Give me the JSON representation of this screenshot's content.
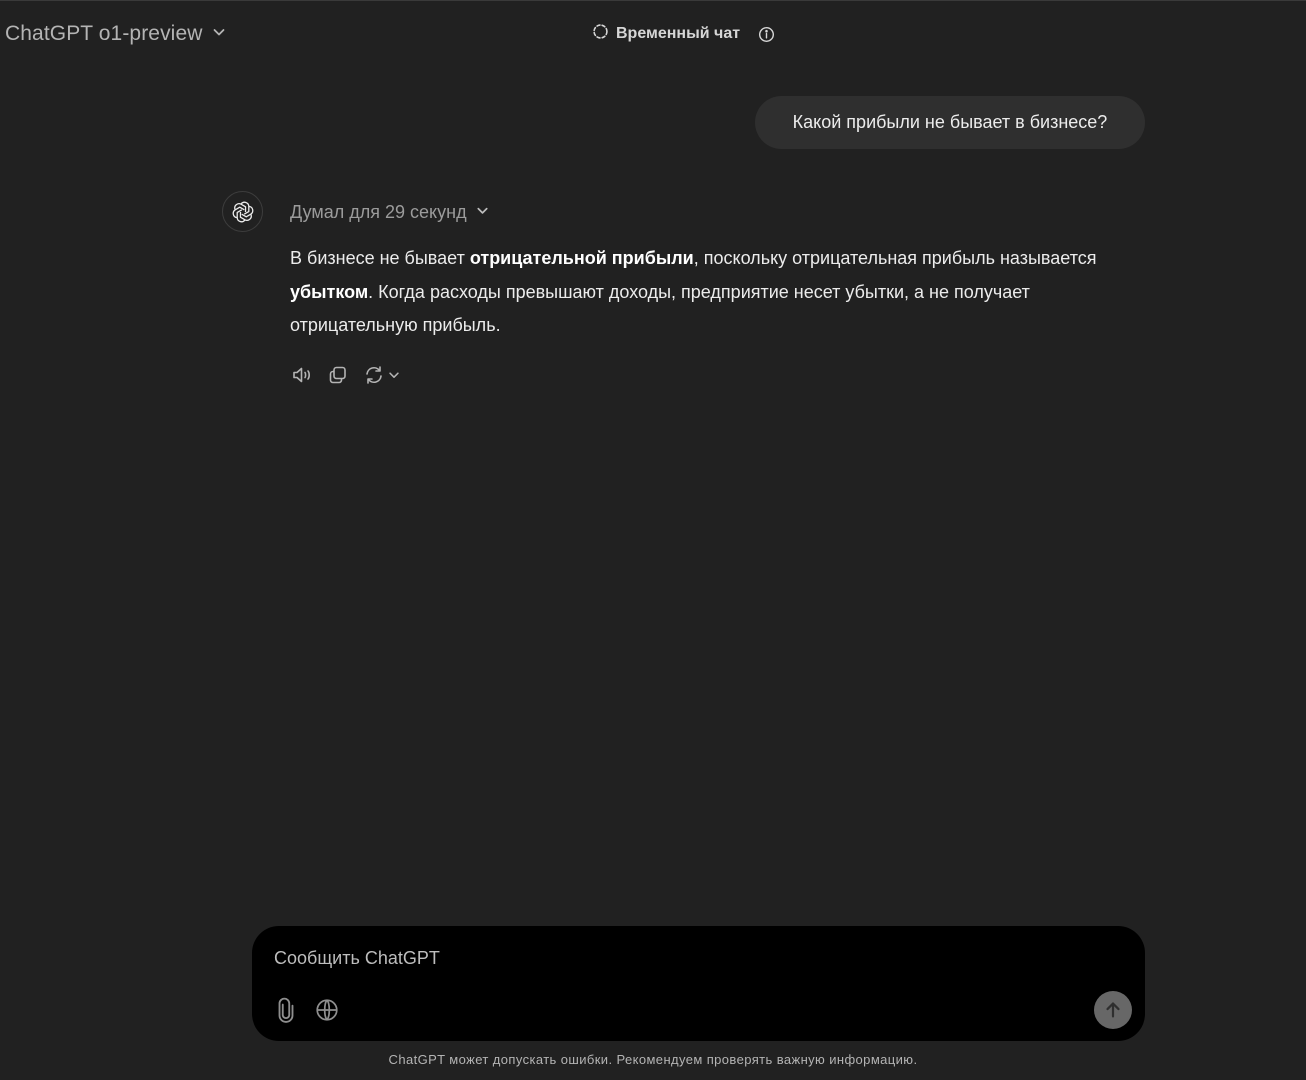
{
  "header": {
    "model_name": "ChatGPT o1-preview",
    "temp_chat_label": "Временный чат"
  },
  "conversation": {
    "user_message": "Какой прибыли не бывает в бизнесе?",
    "thought_label": "Думал для 29 секунд",
    "answer": {
      "p1_a": "В бизнесе не бывает ",
      "p1_bold": "отрицательной прибыли",
      "p1_b": ", поскольку отрицательная прибыль называется ",
      "p1_bold2": "убытком",
      "p1_c": ". Когда расходы превышают доходы, предприятие несет убытки, а не получает отрицательную прибыль."
    },
    "actions": [
      "speaker-icon",
      "copy-icon",
      "regenerate-icon"
    ]
  },
  "composer": {
    "placeholder": "Сообщить ChatGPT",
    "tools": [
      "paperclip-icon",
      "globe-icon"
    ],
    "send_icon": "arrow-up-icon"
  },
  "footer": {
    "disclaimer": "ChatGPT может допускать ошибки. Рекомендуем проверять важную информацию."
  },
  "colors": {
    "background": "#212121",
    "bubble": "#2f2f2f",
    "composer": "#000000",
    "send_button": "#676767"
  }
}
